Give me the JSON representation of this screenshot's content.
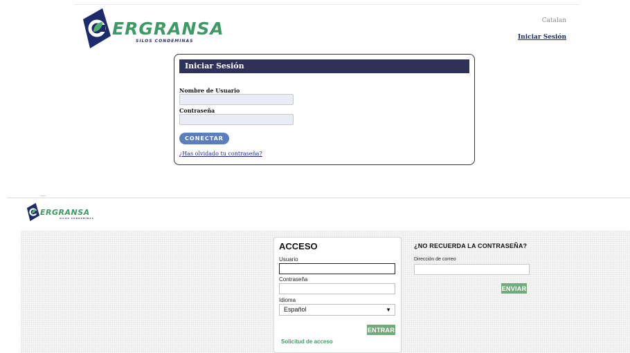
{
  "top": {
    "logo": {
      "word": "ERGRANSA",
      "subtitle": "SILOS CONDEMINAS",
      "colors": {
        "navy": "#1d2a6b",
        "green": "#3e9a64"
      }
    },
    "language_link": "Catalan",
    "signin_link": "Iniciar Sesión",
    "card": {
      "title": "Iniciar Sesión",
      "username_label": "Nombre de Usuario",
      "password_label": "Contraseña",
      "connect_button": "CONECTAR",
      "forgot_link": "¿Has olvidado tu contraseña?"
    },
    "colors": {
      "header_bg": "#2f3158",
      "button": "#5b7fbd",
      "input_bg": "#e9ecf5"
    }
  },
  "bottom": {
    "logo": {
      "word": "ERGRANSA",
      "subtitle": "SILOS CONDEMINAS"
    },
    "access": {
      "title": "ACCESO",
      "user_label": "Usuario",
      "password_label": "Contraseña",
      "language_label": "Idioma",
      "language_selected": "Español",
      "enter_button": "ENTRAR",
      "access_request_link": "Solicitud de acceso"
    },
    "forgot": {
      "title": "¿NO RECUERDA LA CONTRASEÑA?",
      "email_label": "Dirección de correo",
      "send_button": "ENVIAR"
    },
    "colors": {
      "button": "#73aa7c",
      "grid_bg": "#f7f7f7"
    }
  },
  "icons": [
    "logo-emblem-icon",
    "chevron-down-icon"
  ]
}
